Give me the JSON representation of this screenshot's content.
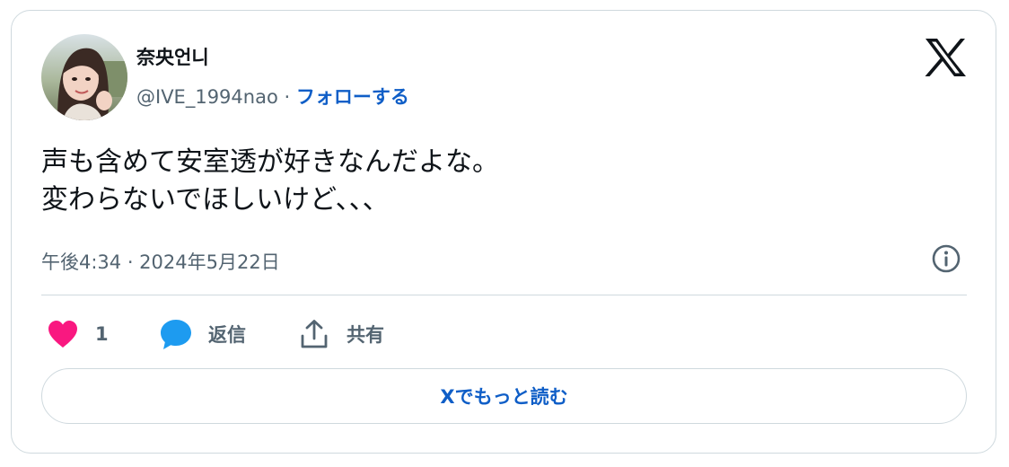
{
  "author": {
    "display_name": "奈央언니",
    "handle": "@IVE_1994nao",
    "separator": "·",
    "follow_label": "フォローする"
  },
  "brand_icon": "x-logo-icon",
  "tweet": {
    "text": "声も含めて安室透が好きなんだよな。\n変わらないでほしいけど、、、",
    "timestamp": "午後4:34 · 2024年5月22日"
  },
  "actions": {
    "like_count": "1",
    "reply_label": "返信",
    "share_label": "共有"
  },
  "read_more_label": "Xでもっと読む",
  "colors": {
    "accent": "#0f5ec7",
    "like": "#f91880",
    "reply": "#1d9bf0",
    "muted": "#536471",
    "border": "#cfd9de"
  }
}
